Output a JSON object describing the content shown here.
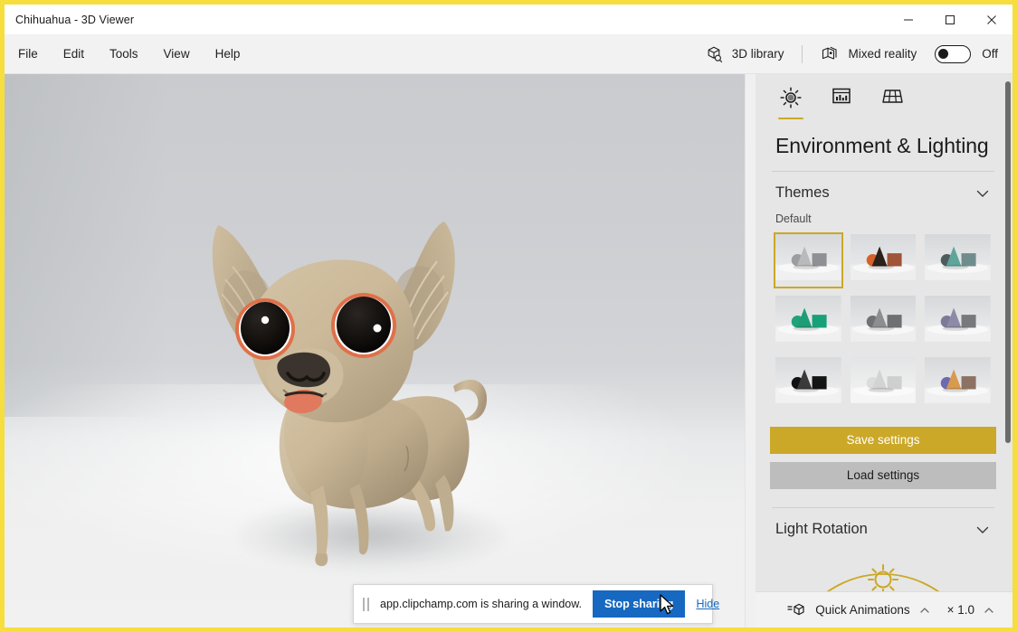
{
  "window": {
    "title": "Chihuahua - 3D Viewer",
    "controls": [
      {
        "name": "minimize",
        "glyph": "─"
      },
      {
        "name": "maximize",
        "glyph": "□"
      },
      {
        "name": "close",
        "glyph": "✕"
      }
    ],
    "border_color": "#f5de3e"
  },
  "menubar": {
    "items": [
      "File",
      "Edit",
      "Tools",
      "View",
      "Help"
    ],
    "library_button": "3D library",
    "library_icon": "cube-search-icon",
    "mixed_reality_label": "Mixed reality",
    "mixed_reality_icon": "layers-icon",
    "mixed_reality_state": "Off",
    "mixed_reality_on": false
  },
  "viewport": {
    "model_name": "chihuahua-3d-model",
    "background": "studio-gray-gradient",
    "model_colors": {
      "body": "#c9b79a",
      "body_shadow": "#a8967a",
      "body_light": "#d8c8ab",
      "eye": "#120f0d",
      "eye_rim": "#e0704a",
      "eye_rim_inner": "#ffffff",
      "nose": "#3b342e",
      "tongue": "#e07a5f",
      "ear_inner": "#b7a589"
    }
  },
  "panel": {
    "tabs": [
      {
        "name": "environment-lighting",
        "icon": "sun-icon",
        "active": true
      },
      {
        "name": "statistics",
        "icon": "chart-frame-icon",
        "active": false
      },
      {
        "name": "grid",
        "icon": "grid-icon",
        "active": false
      }
    ],
    "title": "Environment & Lighting",
    "accent_color": "#cba827",
    "sections": [
      {
        "name": "themes",
        "label": "Themes",
        "expanded": true,
        "chevron": "chevron-down-icon",
        "group_label": "Default",
        "selected_index": 0,
        "thumbnails": [
          {
            "name": "theme-neutral-gray",
            "sphere": "#9b9ea1",
            "cone": "#b9babc",
            "cube": "#8e9093",
            "sky_top": "#d6d8da",
            "sky_bottom": "#f0f0f1",
            "selected": true
          },
          {
            "name": "theme-orange-dark",
            "sphere": "#d4622a",
            "cone": "#2b2119",
            "cube": "#a05438",
            "sky_top": "#d8dadd",
            "sky_bottom": "#eeeeef",
            "selected": false
          },
          {
            "name": "theme-teal",
            "sphere": "#4e5c5e",
            "cone": "#5fa59c",
            "cube": "#6f8d8c",
            "sky_top": "#d5d8da",
            "sky_bottom": "#efefef",
            "selected": false
          },
          {
            "name": "theme-green",
            "sphere": "#1fa37a",
            "cone": "#1e9c76",
            "cube": "#18a179",
            "sky_top": "#d7d9db",
            "sky_bottom": "#f0f0f1",
            "selected": false
          },
          {
            "name": "theme-mid-gray",
            "sphere": "#6f7275",
            "cone": "#8c8e90",
            "cube": "#6e7073",
            "sky_top": "#d4d6d9",
            "sky_bottom": "#eeeeef",
            "selected": false
          },
          {
            "name": "theme-violet",
            "sphere": "#7a7b98",
            "cone": "#8d8aa8",
            "cube": "#77797d",
            "sky_top": "#d6d8da",
            "sky_bottom": "#f0f0f0",
            "selected": false
          },
          {
            "name": "theme-black",
            "sphere": "#121212",
            "cone": "#3a3a3a",
            "cube": "#141414",
            "sky_top": "#d8dadc",
            "sky_bottom": "#f1f1f1",
            "selected": false
          },
          {
            "name": "theme-white",
            "sphere": "#dcdcdc",
            "cone": "#d3d3d3",
            "cube": "#cfcfcf",
            "sky_top": "#e3e4e5",
            "sky_bottom": "#f5f5f5",
            "selected": false
          },
          {
            "name": "theme-purple-orange",
            "sphere": "#6e6ab0",
            "cone": "#d79a4e",
            "cube": "#8d7264",
            "sky_top": "#d7d9db",
            "sky_bottom": "#f0f0f0",
            "selected": false
          }
        ],
        "save_button": "Save settings",
        "load_button": "Load settings"
      },
      {
        "name": "light-rotation",
        "label": "Light Rotation",
        "expanded": true,
        "chevron": "chevron-down-icon",
        "widget": "sun-arc-dial"
      }
    ]
  },
  "statusbar": {
    "quick_animations": {
      "icon": "animation-cube-icon",
      "label": "Quick Animations",
      "chevron": "chevron-up-icon"
    },
    "speed": {
      "label": "× 1.0",
      "chevron": "chevron-up-icon"
    }
  },
  "sharebar": {
    "grip_icon": "drag-handle-icon",
    "message": "app.clipchamp.com is sharing a window.",
    "stop_button": "Stop sharing",
    "hide_link": "Hide",
    "button_color": "#1668c1",
    "cursor": "arrow-cursor"
  }
}
